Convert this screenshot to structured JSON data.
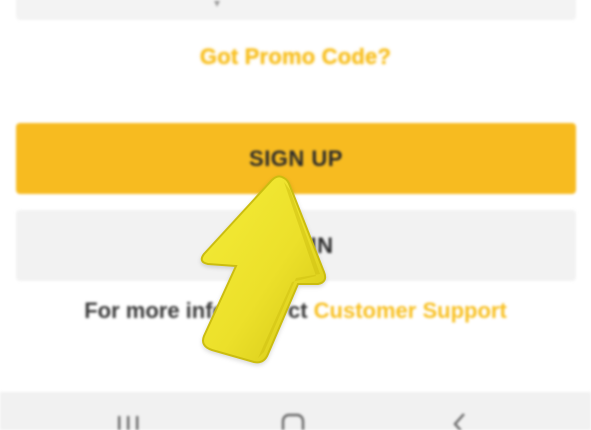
{
  "promo": {
    "label": "Got Promo Code?"
  },
  "buttons": {
    "signup_label": "SIGN UP",
    "login_label": "IN"
  },
  "info": {
    "prefix": "For more info",
    "middle": "ct",
    "link": "Customer Support"
  },
  "colors": {
    "accent": "#f7bb20",
    "link": "#f8c022",
    "secondary_button": "#f2f2f2",
    "nav_bar": "#f1f1f1"
  },
  "icons": {
    "overlay": "pointer-arrow-icon",
    "nav_recent": "recent-apps-icon",
    "nav_home": "home-icon",
    "nav_back": "back-icon"
  }
}
